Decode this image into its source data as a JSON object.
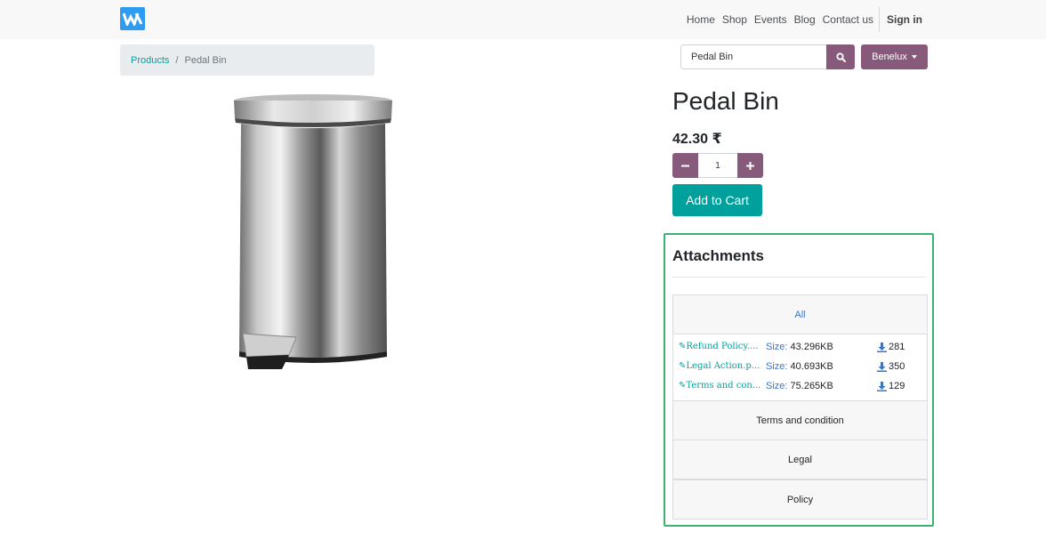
{
  "nav": {
    "items": [
      "Home",
      "Shop",
      "Events",
      "Blog",
      "Contact us"
    ],
    "signin": "Sign in"
  },
  "breadcrumb": {
    "parent": "Products",
    "separator": "/",
    "current": "Pedal Bin"
  },
  "search": {
    "value": "Pedal Bin",
    "icon": "search-icon"
  },
  "pricelist": {
    "label": "Benelux"
  },
  "product": {
    "name": "Pedal Bin",
    "price": "42.30 ₹",
    "quantity": "1",
    "minus_icon": "minus-icon",
    "plus_icon": "plus-icon",
    "add_to_cart": "Add to Cart"
  },
  "attachments": {
    "title": "Attachments",
    "all_label": "All",
    "size_label": "Size:",
    "files": [
      {
        "name": "Refund Policy....",
        "size": "43.296KB",
        "downloads": "281"
      },
      {
        "name": "Legal Action.p...",
        "size": "40.693KB",
        "downloads": "350"
      },
      {
        "name": "Terms and con...",
        "size": "75.265KB",
        "downloads": "129"
      }
    ],
    "groups": [
      "Terms and condition",
      "Legal",
      "Policy"
    ]
  },
  "colors": {
    "brand": "#875a7b",
    "accent": "#00a09d",
    "highlight_border": "#3cb371",
    "logo": "#2e9cf0"
  }
}
